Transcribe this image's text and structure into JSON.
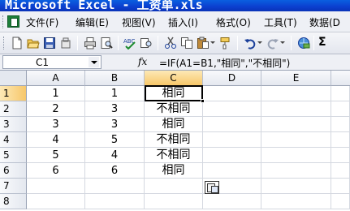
{
  "window": {
    "title": "Microsoft Excel - 工资单.xls"
  },
  "menu": {
    "items": [
      "文件(F)",
      "编辑(E)",
      "视图(V)",
      "插入(I)",
      "格式(O)",
      "工具(T)",
      "数据(D"
    ]
  },
  "toolbar": {
    "icons": [
      "new-icon",
      "open-icon",
      "save-icon",
      "permission-icon",
      "print-icon",
      "print-preview-icon",
      "spelling-icon",
      "research-icon",
      "cut-icon",
      "copy-icon",
      "paste-icon",
      "format-painter-icon",
      "undo-icon",
      "redo-icon",
      "hyperlink-icon",
      "autosum-icon"
    ],
    "autosum_label": "Σ"
  },
  "formula_bar": {
    "name_box": "C1",
    "fx_label": "fx",
    "formula": "=IF(A1=B1,\"相同\",\"不相同\")"
  },
  "sheet": {
    "columns": [
      "A",
      "B",
      "C",
      "D",
      "E"
    ],
    "active_column": "C",
    "active_row": "1",
    "rows": [
      {
        "num": "1",
        "A": "1",
        "B": "1",
        "C": "相同"
      },
      {
        "num": "2",
        "A": "2",
        "B": "3",
        "C": "不相同"
      },
      {
        "num": "3",
        "A": "3",
        "B": "3",
        "C": "相同"
      },
      {
        "num": "4",
        "A": "4",
        "B": "5",
        "C": "不相同"
      },
      {
        "num": "5",
        "A": "5",
        "B": "4",
        "C": "不相同"
      },
      {
        "num": "6",
        "A": "6",
        "B": "6",
        "C": "相同"
      },
      {
        "num": "7",
        "A": "",
        "B": "",
        "C": ""
      },
      {
        "num": "8",
        "A": "",
        "B": "",
        "C": ""
      }
    ]
  },
  "colors": {
    "title_bar": "#0b3fcf",
    "active_header": "#f7c76a",
    "gridline": "#d4d8e0"
  }
}
